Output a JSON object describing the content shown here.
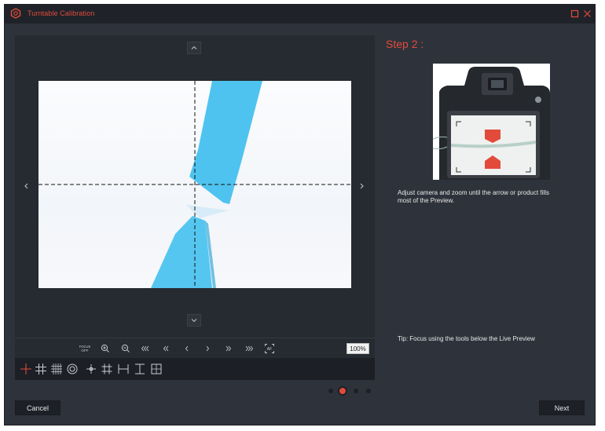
{
  "window": {
    "title": "Turntable Calibration"
  },
  "step": {
    "title": "Step 2 :",
    "instruction": "Adjust camera and zoom until the arrow or product fills most of the Preview.",
    "tip": "Tip:  Focus using the tools below the Live Preview"
  },
  "toolbar": {
    "focus_off_label": "FOCUS\nOFF",
    "zoom_level": "100%",
    "icons": [
      "focus-off-icon",
      "zoom-in-icon",
      "zoom-out-icon",
      "fast-backward-icon",
      "backward-icon",
      "step-backward-icon",
      "step-forward-icon",
      "forward-icon",
      "fast-forward-icon",
      "autofocus-icon"
    ],
    "af_label": "AF"
  },
  "overlays": {
    "icons": [
      "crosshair-icon",
      "grid-3x3-icon",
      "grid-dense-icon",
      "target-circle-icon",
      "center-cross-icon",
      "grid-hash-icon",
      "horizontal-guide-icon",
      "vertical-guide-icon",
      "boxed-grid-icon"
    ],
    "active_index": 0
  },
  "pagination": {
    "pages": 4,
    "current": 2
  },
  "buttons": {
    "cancel": "Cancel",
    "next": "Next"
  },
  "colors": {
    "accent": "#e24b3b",
    "window_bg": "#2e333b",
    "panel_bg": "#262a31",
    "preview_object": "#4fc3ef"
  }
}
